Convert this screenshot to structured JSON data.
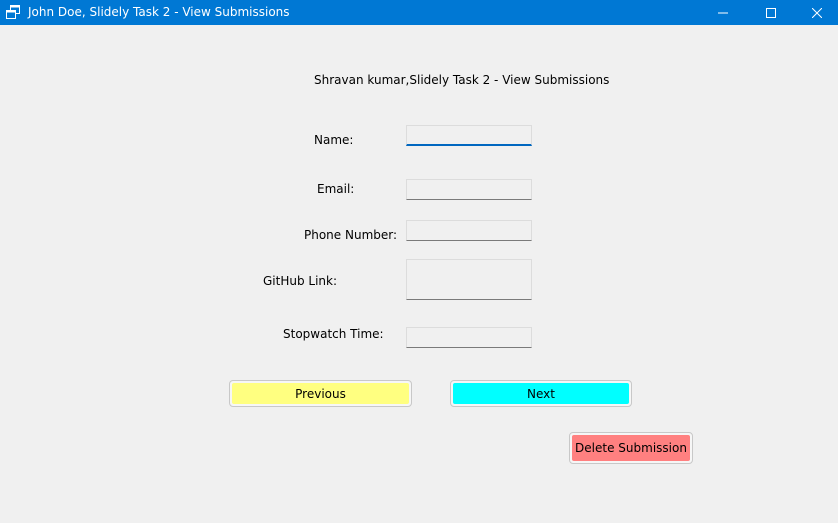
{
  "window": {
    "title": "John Doe, Slidely Task 2 - View Submissions",
    "accent_color": "#0078d4",
    "controls": {
      "minimize_icon": "minimize-icon",
      "maximize_icon": "maximize-icon",
      "close_icon": "close-icon"
    }
  },
  "form": {
    "header": "Shravan kumar,Slidely Task 2 - View Submissions",
    "name_label": "Name:",
    "name_value": "",
    "email_label": "Email:",
    "email_value": "",
    "phone_label": "Phone Number:",
    "phone_value": "",
    "github_label": "GitHub Link:",
    "github_value": "",
    "stopwatch_label": "Stopwatch Time:",
    "stopwatch_value": ""
  },
  "buttons": {
    "previous_label": "Previous",
    "previous_color": "#ffff80",
    "next_label": "Next",
    "next_color": "#00ffff",
    "delete_label": "Delete Submission",
    "delete_color": "#ff8080"
  }
}
